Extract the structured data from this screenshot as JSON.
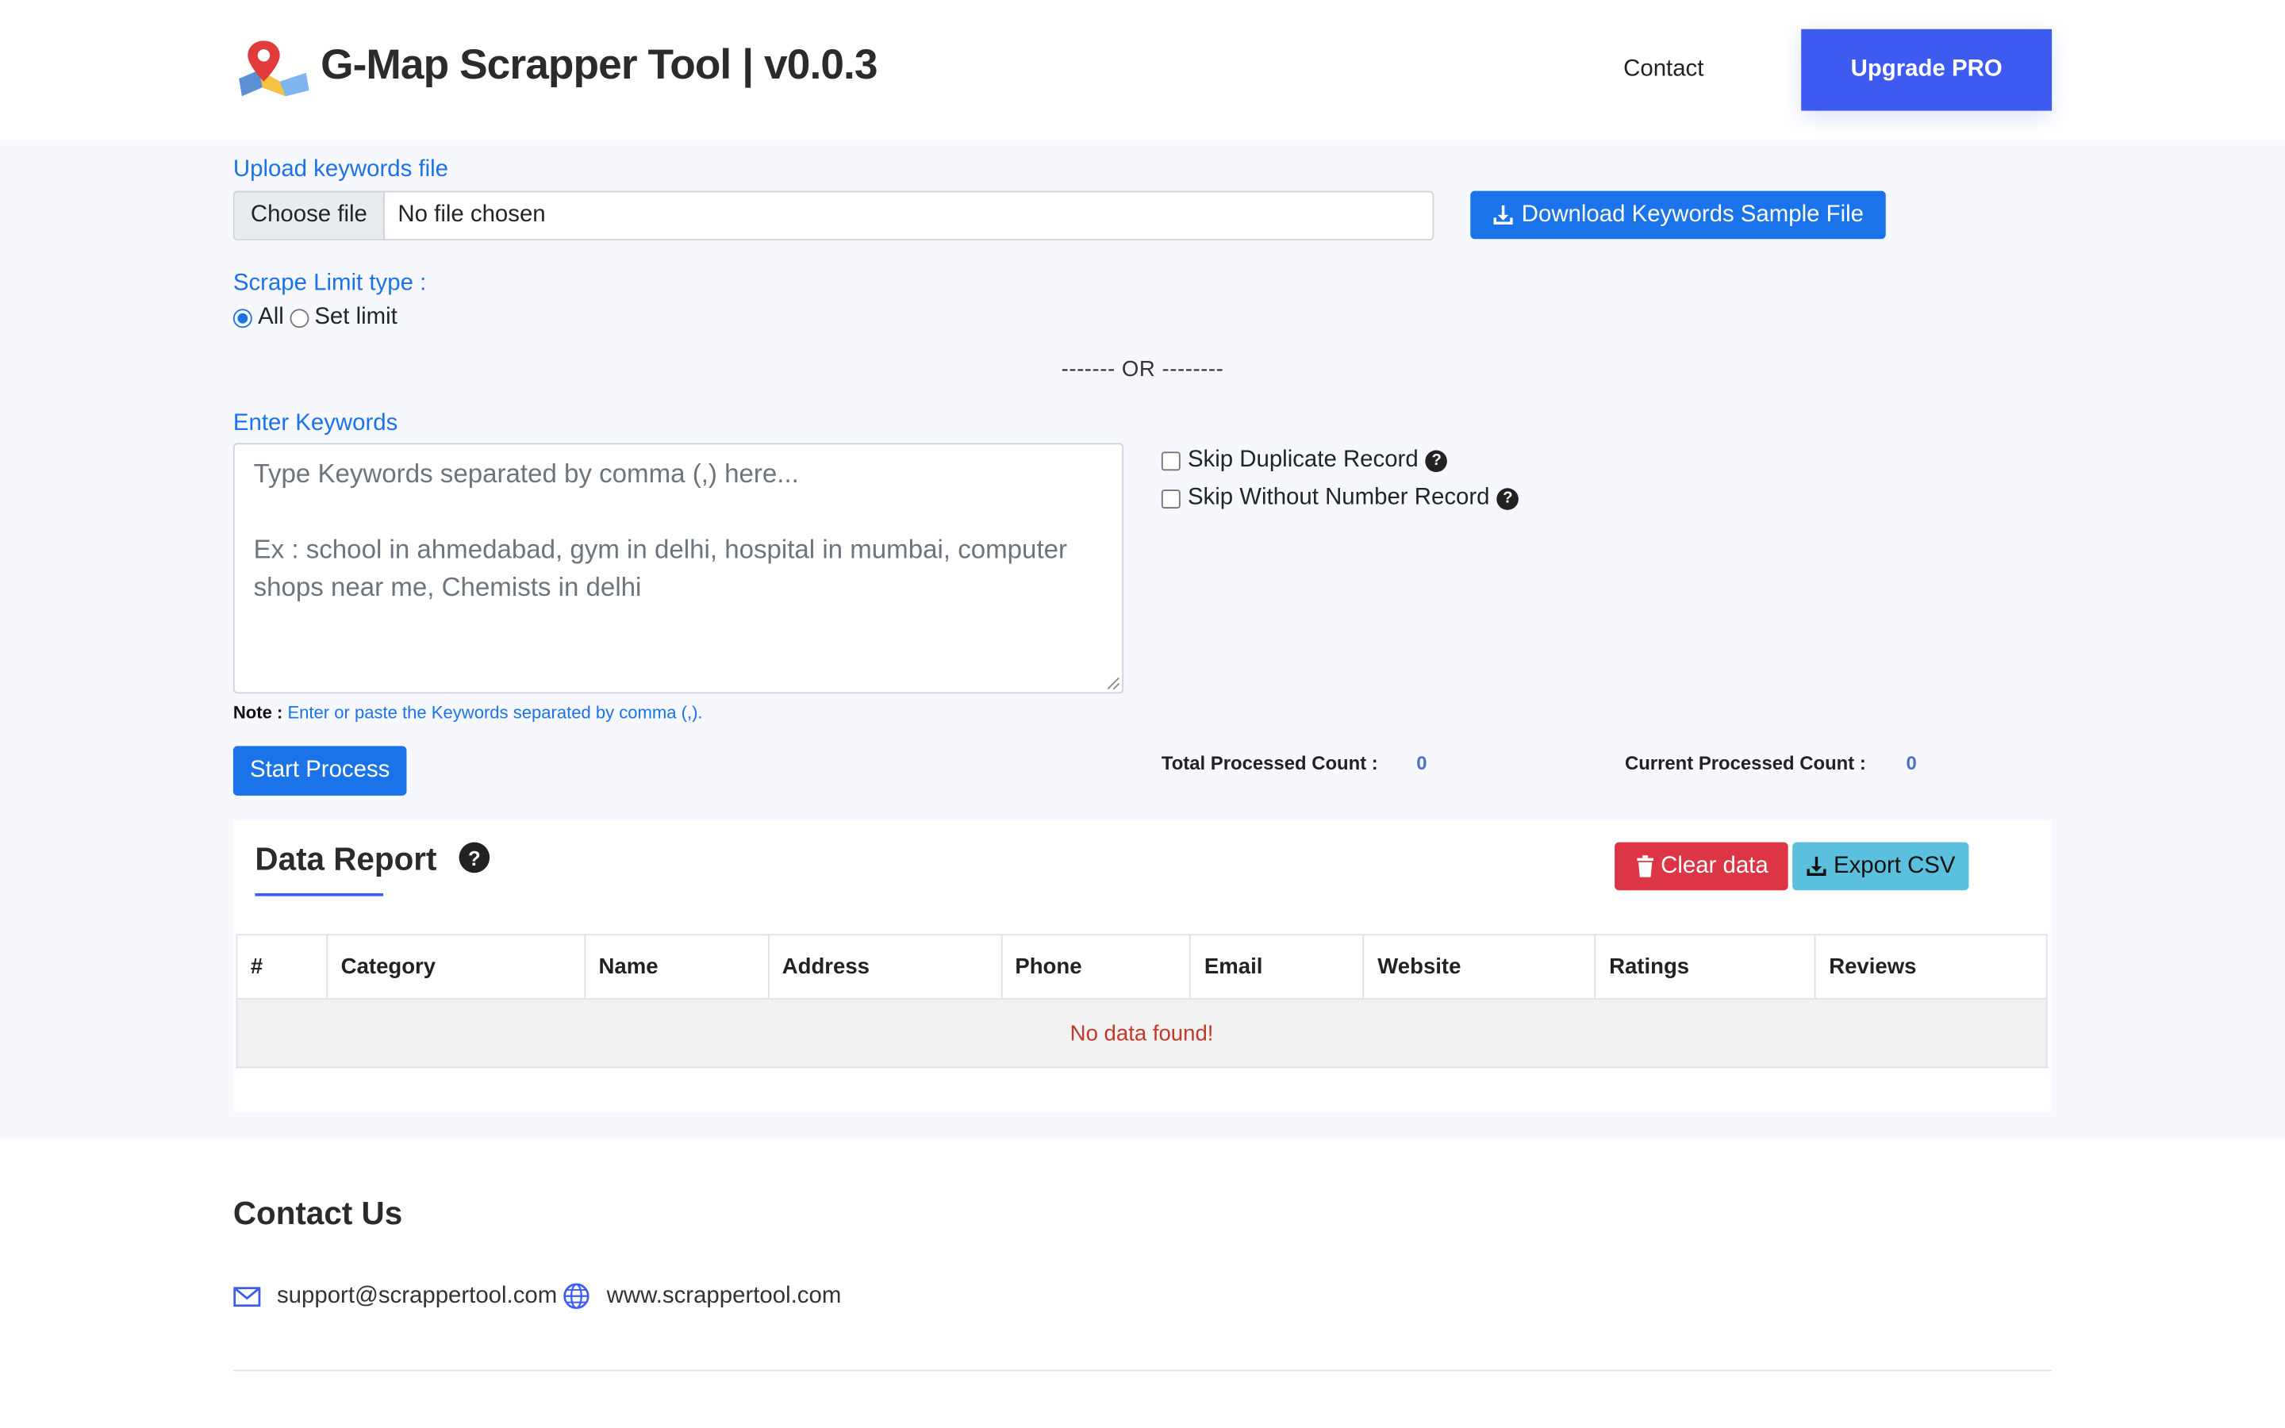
{
  "header": {
    "app_title": "G-Map Scrapper Tool | v0.0.3",
    "nav_contact": "Contact",
    "upgrade_label": "Upgrade PRO",
    "logo_icon": "map-pin-logo-icon"
  },
  "upload": {
    "label": "Upload keywords file",
    "choose_file": "Choose file",
    "file_status": "No file chosen",
    "download_sample": "Download Keywords Sample File"
  },
  "scrape_limit": {
    "label": "Scrape Limit type :",
    "options": [
      "All",
      "Set limit"
    ],
    "selected": "All"
  },
  "separator": "------- OR --------",
  "keywords": {
    "label": "Enter Keywords",
    "placeholder": "Type Keywords separated by comma (,) here...\n\nEx : school in ahmedabad, gym in delhi, hospital in mumbai, computer shops near me, Chemists in delhi",
    "value": ""
  },
  "options": {
    "skip_duplicate": "Skip Duplicate Record",
    "skip_without_number": "Skip Without Number Record",
    "skip_duplicate_checked": false,
    "skip_without_number_checked": false
  },
  "note": {
    "prefix": "Note :",
    "text": "Enter or paste the Keywords separated by comma (,)."
  },
  "start_button": "Start Process",
  "counts": {
    "total_label": "Total Processed Count :",
    "total_value": "0",
    "current_label": "Current Processed Count :",
    "current_value": "0"
  },
  "report": {
    "title": "Data Report",
    "help_icon": "?",
    "clear_label": "Clear data",
    "export_label": "Export CSV",
    "columns": [
      "#",
      "Category",
      "Name",
      "Address",
      "Phone",
      "Email",
      "Website",
      "Ratings",
      "Reviews"
    ],
    "empty_message": "No data found!"
  },
  "contact": {
    "title": "Contact Us",
    "email": "support@scrappertool.com",
    "website": "www.scrappertool.com"
  },
  "colors": {
    "primary": "#1a73e8",
    "upgrade": "#3d5af1",
    "danger": "#dc3545",
    "info": "#5bc0de",
    "page_tint": "#f6f8fe"
  }
}
